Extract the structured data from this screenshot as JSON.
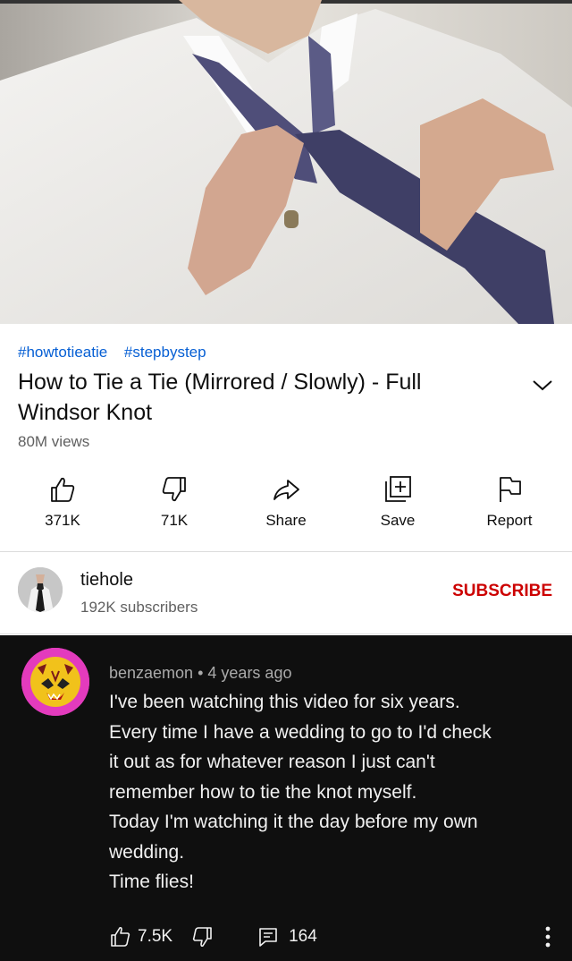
{
  "video": {
    "thumbnail": "man-tying-tie-frame"
  },
  "hashtags": [
    "#howtotieatie",
    "#stepbystep"
  ],
  "title": "How to Tie a Tie (Mirrored / Slowly) - Full Windsor Knot",
  "views": "80M views",
  "actions": [
    {
      "label": "371K",
      "icon": "thumbs-up-icon"
    },
    {
      "label": "71K",
      "icon": "thumbs-down-icon"
    },
    {
      "label": "Share",
      "icon": "share-icon"
    },
    {
      "label": "Save",
      "icon": "save-playlist-icon"
    },
    {
      "label": "Report",
      "icon": "flag-icon"
    }
  ],
  "channel": {
    "name": "tiehole",
    "subscribers": "192K subscribers",
    "subscribe_label": "SUBSCRIBE"
  },
  "comment": {
    "author": "benzaemon",
    "time": "4 years ago",
    "lines": [
      "I've been watching this video for six years.",
      "Every time I have a wedding to go to I'd check",
      "it out as for whatever reason I just can't",
      "remember how to tie the knot myself.",
      "Today I'm watching it the day before my own",
      "wedding.",
      "Time flies!"
    ],
    "likes": "7.5K",
    "replies": "164"
  },
  "colors": {
    "link": "#065fd4",
    "subscribe": "#cc0000",
    "comment_bg": "#0f0f0f"
  }
}
